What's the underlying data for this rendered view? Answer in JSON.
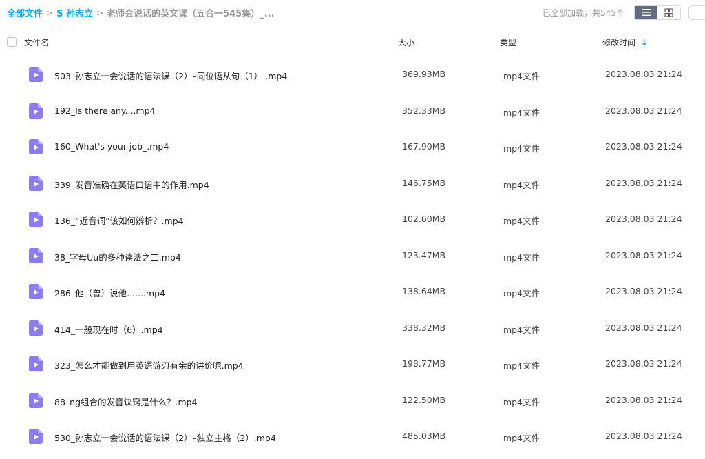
{
  "breadcrumb": {
    "root": "全部文件",
    "folder": "S 孙志立",
    "current": "老师会说话的英文课（五合一545集）_..."
  },
  "status": {
    "loaded": "已全部加载，共545个"
  },
  "icons": {
    "list_view": "list-icon",
    "grid_view": "grid-icon",
    "file": "video-file-icon",
    "sort": "sort-icon"
  },
  "colors": {
    "accent": "#06a7ff",
    "file_icon": "#8b7cf6",
    "view_active": "#636d7e"
  },
  "table": {
    "headers": {
      "name": "文件名",
      "size": "大小",
      "type": "类型",
      "date": "修改时间"
    },
    "rows": [
      {
        "name": "503_孙志立一会说话的语法课（2）–同位语从句（1） .mp4",
        "size": "369.93MB",
        "type": "mp4文件",
        "date": "2023.08.03 21:24"
      },
      {
        "name": "192_Is there any....mp4",
        "size": "352.33MB",
        "type": "mp4文件",
        "date": "2023.08.03 21:24"
      },
      {
        "name": "160_What's your job_.mp4",
        "size": "167.90MB",
        "type": "mp4文件",
        "date": "2023.08.03 21:24"
      },
      {
        "name": "339_发音准确在英语口语中的作用.mp4",
        "size": "146.75MB",
        "type": "mp4文件",
        "date": "2023.08.03 21:24"
      },
      {
        "name": "136_“近音词”该如何辨析？.mp4",
        "size": "102.60MB",
        "type": "mp4文件",
        "date": "2023.08.03 21:24"
      },
      {
        "name": "38_字母Uu的多种读法之二.mp4",
        "size": "123.47MB",
        "type": "mp4文件",
        "date": "2023.08.03 21:24"
      },
      {
        "name": "286_他（曾）说他.......mp4",
        "size": "138.64MB",
        "type": "mp4文件",
        "date": "2023.08.03 21:24"
      },
      {
        "name": "414_一般现在时（6）.mp4",
        "size": "338.32MB",
        "type": "mp4文件",
        "date": "2023.08.03 21:24"
      },
      {
        "name": "323_怎么才能做到用英语游刃有余的讲价呢.mp4",
        "size": "198.77MB",
        "type": "mp4文件",
        "date": "2023.08.03 21:24"
      },
      {
        "name": "88_ng组合的发音诀窍是什么？.mp4",
        "size": "122.50MB",
        "type": "mp4文件",
        "date": "2023.08.03 21:24"
      },
      {
        "name": "530_孙志立一会说话的语法课（2）–独立主格（2）.mp4",
        "size": "485.03MB",
        "type": "mp4文件",
        "date": "2023.08.03 21:24"
      }
    ]
  }
}
